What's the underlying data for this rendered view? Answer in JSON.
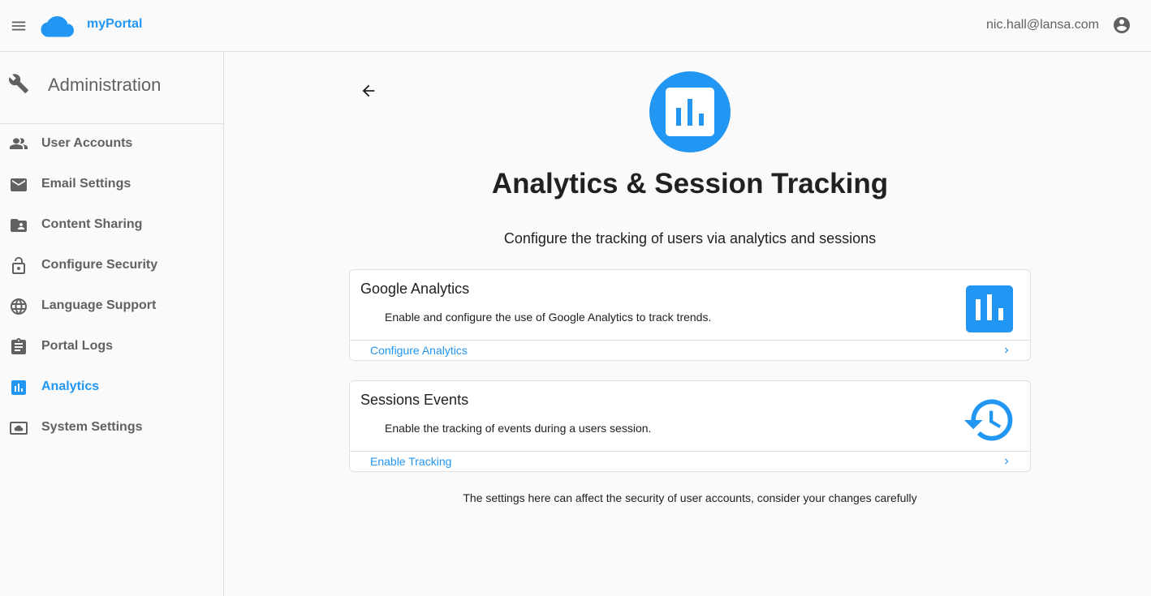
{
  "header": {
    "app_title": "myPortal",
    "user_email": "nic.hall@lansa.com",
    "menu_icon": "hamburger-menu-icon",
    "logo_icon": "cloud-icon",
    "account_icon": "account-circle-icon"
  },
  "sidebar": {
    "title": "Administration",
    "title_icon": "wrench-icon",
    "items": [
      {
        "label": "User Accounts",
        "icon": "people-icon",
        "active": false
      },
      {
        "label": "Email Settings",
        "icon": "mail-icon",
        "active": false
      },
      {
        "label": "Content Sharing",
        "icon": "folder-shared-icon",
        "active": false
      },
      {
        "label": "Configure Security",
        "icon": "lock-open-icon",
        "active": false
      },
      {
        "label": "Language Support",
        "icon": "globe-icon",
        "active": false
      },
      {
        "label": "Portal Logs",
        "icon": "clipboard-icon",
        "active": false
      },
      {
        "label": "Analytics",
        "icon": "bar-chart-icon",
        "active": true
      },
      {
        "label": "System Settings",
        "icon": "cloud-settings-icon",
        "active": false
      }
    ]
  },
  "main": {
    "back_icon": "arrow-left-icon",
    "hero_icon": "bar-chart-icon",
    "title": "Analytics & Session Tracking",
    "subtitle": "Configure the tracking of users via analytics and sessions",
    "cards": [
      {
        "title": "Google Analytics",
        "description": "Enable and configure the use of Google Analytics to track trends.",
        "link": "Configure Analytics",
        "icon": "bar-chart-icon"
      },
      {
        "title": "Sessions Events",
        "description": "Enable the tracking of events during a users session.",
        "link": "Enable Tracking",
        "icon": "history-icon"
      }
    ],
    "footer_note": "The settings here can affect the security of user accounts, consider your changes carefully"
  },
  "colors": {
    "accent": "#2196f3",
    "text_primary": "#212121",
    "text_secondary": "#616161",
    "divider": "#e0e0e0",
    "background": "#fafafa"
  }
}
